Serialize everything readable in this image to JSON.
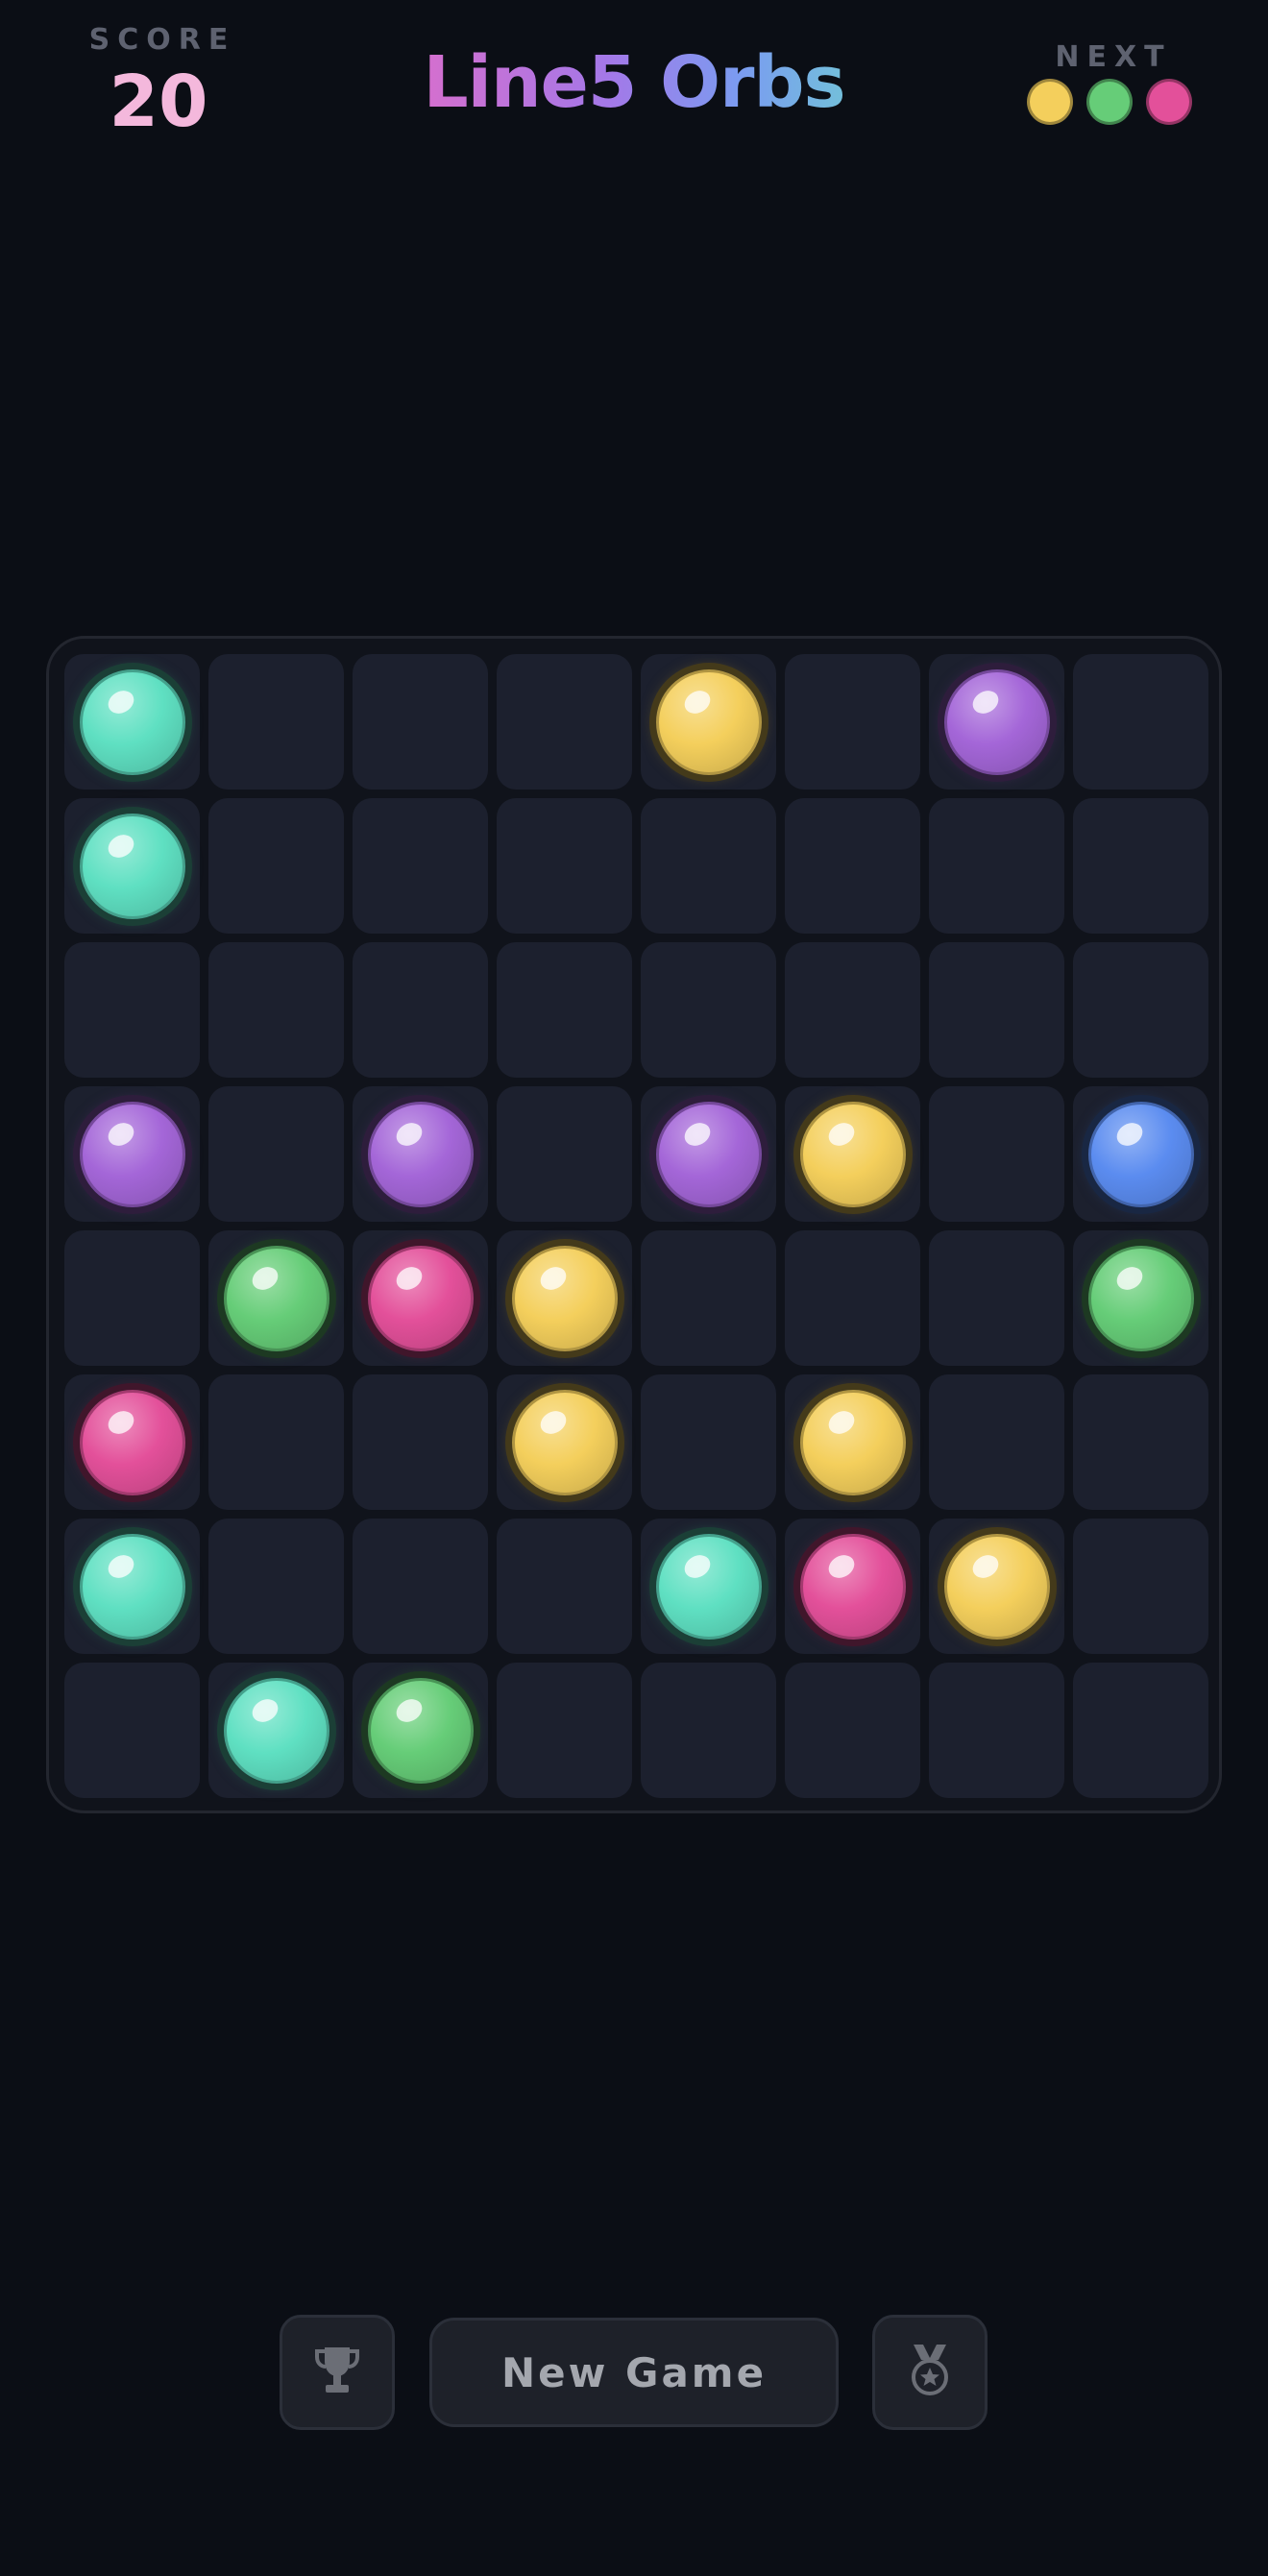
{
  "header": {
    "score_label": "SCORE",
    "score_value": "20",
    "title": "Line5 Orbs",
    "next_label": "NEXT",
    "next_orbs": [
      "yellow",
      "green",
      "pink"
    ]
  },
  "colors": {
    "teal": "#5fe0c2",
    "blue": "#5b8cf0",
    "yellow": "#f4cf5c",
    "purple": "#a466d8",
    "green": "#66cd78",
    "pink": "#e3509a",
    "background": "#0b0e15",
    "cell": "#1c202e"
  },
  "board": {
    "rows": 8,
    "cols": 8,
    "cells": [
      [
        "teal",
        null,
        null,
        null,
        "yellow",
        null,
        "purple",
        null
      ],
      [
        "teal",
        null,
        null,
        null,
        null,
        null,
        null,
        null
      ],
      [
        null,
        null,
        null,
        null,
        null,
        null,
        null,
        null
      ],
      [
        "purple",
        null,
        "purple",
        null,
        "purple",
        "yellow",
        null,
        "blue"
      ],
      [
        null,
        "green",
        "pink",
        "yellow",
        null,
        null,
        null,
        "green"
      ],
      [
        "pink",
        null,
        null,
        "yellow",
        null,
        "yellow",
        null,
        null
      ],
      [
        "teal",
        null,
        null,
        null,
        "teal",
        "pink",
        "yellow",
        null
      ],
      [
        null,
        "teal",
        "green",
        null,
        null,
        null,
        null,
        null
      ]
    ]
  },
  "controls": {
    "leaderboard_icon": "trophy-icon",
    "new_game_label": "New Game",
    "achievements_icon": "medal-icon"
  }
}
